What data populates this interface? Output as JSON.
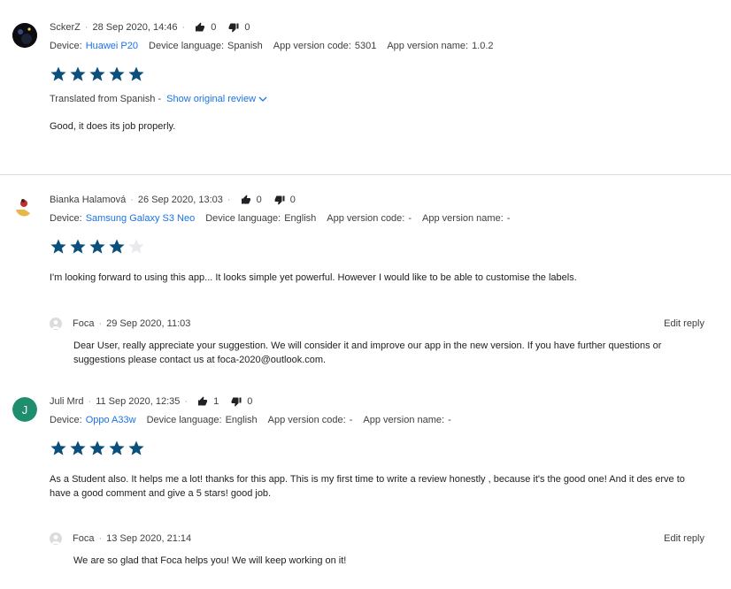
{
  "reviews": [
    {
      "author": "SckerZ",
      "date": "28 Sep 2020, 14:46",
      "likes": "0",
      "dislikes": "0",
      "device_label": "Device:",
      "device": "Huawei P20",
      "language_label": "Device language:",
      "language": "Spanish",
      "code_label": "App version code:",
      "code": "5301",
      "name_label": "App version name:",
      "name": "1.0.2",
      "rating": 5,
      "translated_label": "Translated from Spanish -",
      "show_original": "Show original review",
      "text": "Good, it does its job properly."
    },
    {
      "author": "Bianka Halamová",
      "date": "26 Sep 2020, 13:03",
      "likes": "0",
      "dislikes": "0",
      "device_label": "Device:",
      "device": "Samsung Galaxy S3 Neo",
      "language_label": "Device language:",
      "language": "English",
      "code_label": "App version code:",
      "code": "-",
      "name_label": "App version name:",
      "name": "-",
      "rating": 4,
      "text": "I'm looking forward to using this app... It looks simple yet powerful. However I would like to be able to customise the labels.",
      "reply": {
        "author": "Foca",
        "date": "29 Sep 2020, 11:03",
        "edit_label": "Edit reply",
        "text": "Dear User, really appreciate your suggestion. We will consider it and improve our app in the new version. If you have further questions or suggestions please contact us at foca-2020@outlook.com."
      }
    },
    {
      "author": "Juli Mrd",
      "avatar_letter": "J",
      "avatar_color": "#1e8e6e",
      "date": "11 Sep 2020, 12:35",
      "likes": "1",
      "dislikes": "0",
      "device_label": "Device:",
      "device": "Oppo A33w",
      "language_label": "Device language:",
      "language": "English",
      "code_label": "App version code:",
      "code": "-",
      "name_label": "App version name:",
      "name": "-",
      "rating": 5,
      "text": "As a Student also. It helps me a lot! thanks for this app. This is my first time to write a review honestly , because it's the good one! And it des erve to have a good comment and give a 5 stars! good job.",
      "reply": {
        "author": "Foca",
        "date": "13 Sep 2020, 21:14",
        "edit_label": "Edit reply",
        "text": "We are so glad that Foca helps you! We will keep working on it!"
      }
    }
  ],
  "colors": {
    "star_filled": "#0b4f7c",
    "star_empty": "#e8eaed",
    "link": "#1a73e8"
  }
}
